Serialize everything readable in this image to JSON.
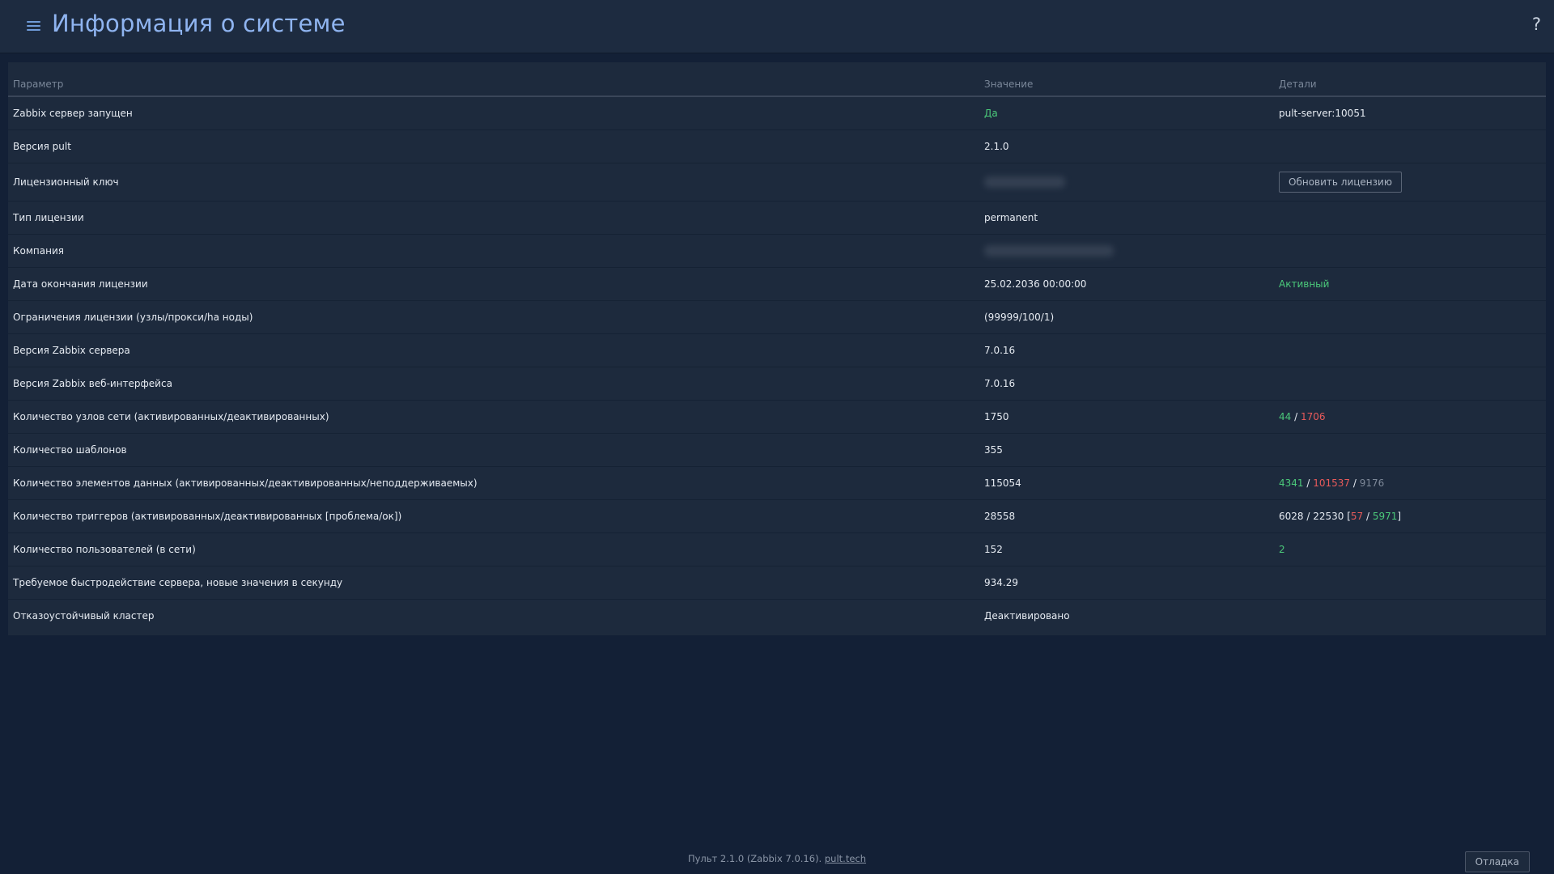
{
  "header": {
    "title": "Информация о системе",
    "help_label": "?"
  },
  "table": {
    "columns": [
      "Параметр",
      "Значение",
      "Детали"
    ],
    "rows": [
      {
        "param": "Zabbix сервер запущен",
        "value": "Да",
        "details": "pult-server:10051"
      },
      {
        "param": "Версия pult",
        "value": "2.1.0"
      },
      {
        "param": "Лицензионный ключ",
        "details_button": "Обновить лицензию"
      },
      {
        "param": "Тип лицензии",
        "value": "permanent"
      },
      {
        "param": "Компания"
      },
      {
        "param": "Дата окончания лицензии",
        "value": "25.02.2036 00:00:00",
        "details": "Активный"
      },
      {
        "param": "Ограничения лицензии (узлы/прокси/ha ноды)",
        "value": "(99999/100/1)"
      },
      {
        "param": "Версия Zabbix сервера",
        "value": "7.0.16"
      },
      {
        "param": "Версия Zabbix веб-интерфейса",
        "value": "7.0.16"
      },
      {
        "param": "Количество узлов сети (активированных/деактивированных)",
        "value": "1750",
        "details": {
          "enabled": "44",
          "sep": " / ",
          "disabled": "1706"
        }
      },
      {
        "param": "Количество шаблонов",
        "value": "355"
      },
      {
        "param": "Количество элементов данных (активированных/деактивированных/неподдерживаемых)",
        "value": "115054",
        "details": {
          "enabled": "4341",
          "sep1": " / ",
          "disabled": "101537",
          "sep2": " / ",
          "unsupported": "9176"
        }
      },
      {
        "param": "Количество триггеров (активированных/деактивированных [проблема/ок])",
        "value": "28558",
        "details": {
          "prefix": "6028 / 22530 [",
          "problem": "57",
          "sep": " / ",
          "ok": "5971",
          "suffix": "]"
        }
      },
      {
        "param": "Количество пользователей (в сети)",
        "value": "152",
        "details": "2"
      },
      {
        "param": "Требуемое быстродействие сервера, новые значения в секунду",
        "value": "934.29"
      },
      {
        "param": "Отказоустойчивый кластер",
        "value": "Деактивировано"
      }
    ]
  },
  "footer": {
    "text": "Пульт 2.1.0 (Zabbix 7.0.16).",
    "link": "pult.tech",
    "debug_label": "Отладка"
  },
  "colors": {
    "background": "#132036",
    "panel": "#1d2a3d",
    "title": "#8fb4f0",
    "ok_green": "#4bc97a",
    "problem_red": "#e85a5a"
  }
}
